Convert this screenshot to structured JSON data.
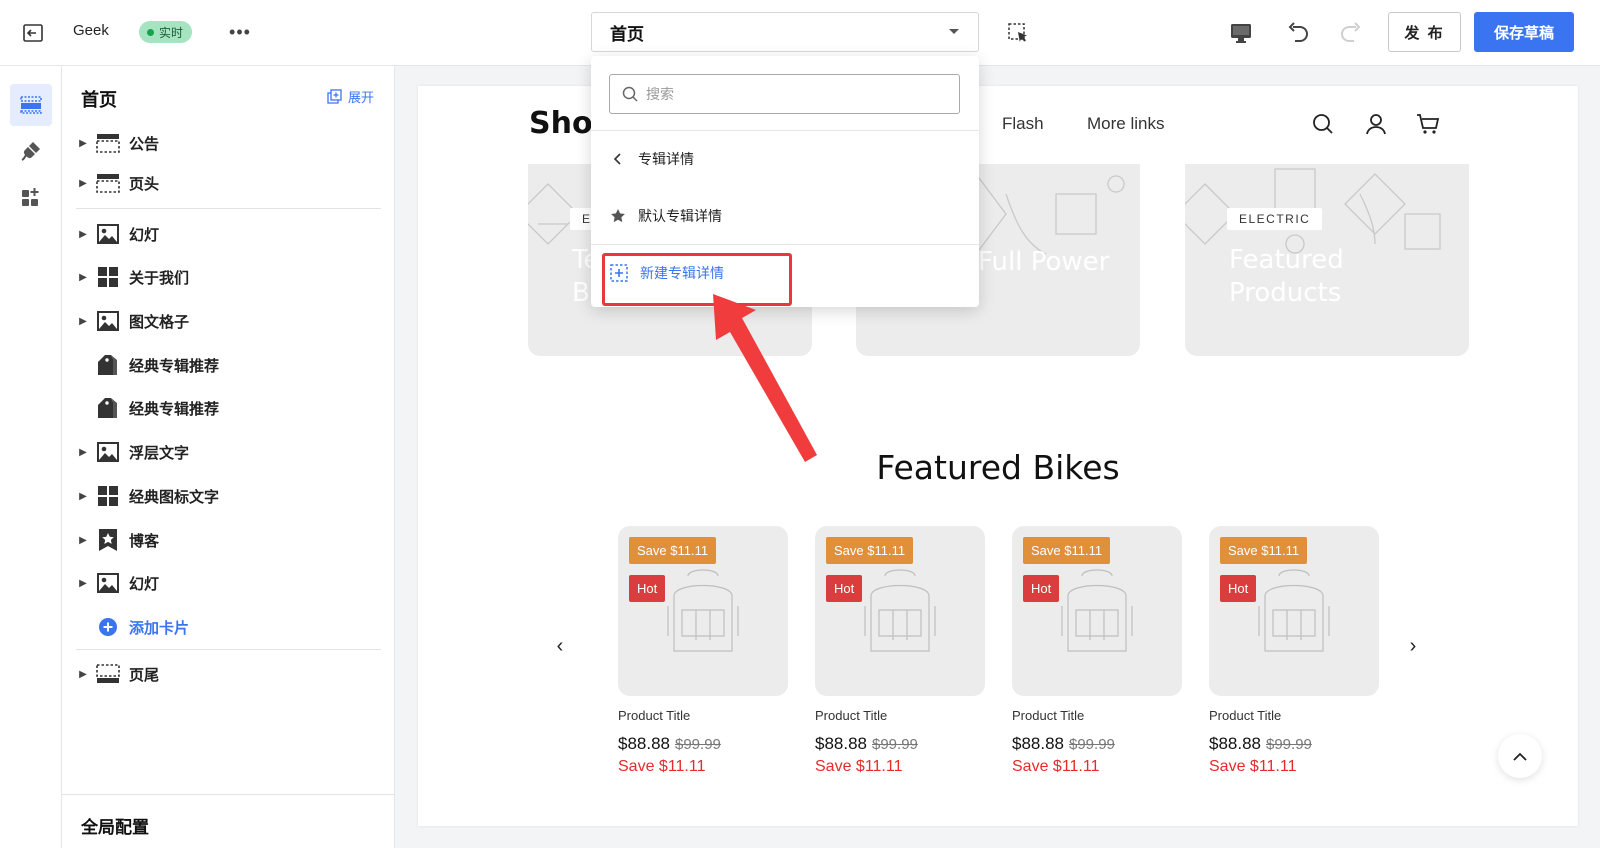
{
  "topbar": {
    "store_name": "Geek",
    "status_badge": "实时",
    "more": "•••",
    "page_select": "首页",
    "publish_label": "发 布",
    "save_draft_label": "保存草稿"
  },
  "sidebar": {
    "title": "首页",
    "expand_label": "展开",
    "items": [
      {
        "label": "公告",
        "icon": "header-section-icon",
        "caret": true
      },
      {
        "label": "页头",
        "icon": "header-section-icon",
        "caret": true
      },
      {
        "label": "幻灯",
        "icon": "image-icon",
        "caret": true
      },
      {
        "label": "关于我们",
        "icon": "grid-icon",
        "caret": true
      },
      {
        "label": "图文格子",
        "icon": "image-icon",
        "caret": true
      },
      {
        "label": "经典专辑推荐",
        "icon": "tag-icon",
        "caret": false
      },
      {
        "label": "经典专辑推荐",
        "icon": "tag-icon",
        "caret": false
      },
      {
        "label": "浮层文字",
        "icon": "image-icon",
        "caret": true
      },
      {
        "label": "经典图标文字",
        "icon": "grid-icon",
        "caret": true
      },
      {
        "label": "博客",
        "icon": "star-bookmark-icon",
        "caret": true
      },
      {
        "label": "幻灯",
        "icon": "image-icon",
        "caret": true
      }
    ],
    "add_card_label": "添加卡片",
    "footer_item": "页尾",
    "global_config": "全局配置"
  },
  "canvas": {
    "logo": "Shop",
    "nav_links": [
      "Flash",
      "More links"
    ],
    "collections": [
      {
        "tag": "E",
        "title": "Te\nB"
      },
      {
        "tag": "",
        "title": "Full Power"
      },
      {
        "tag": "ELECTRIC",
        "title": "Featured\nProducts"
      }
    ],
    "section_title": "Featured Bikes",
    "products": [
      {
        "save_badge": "Save $11.11",
        "hot_badge": "Hot",
        "title": "Product Title",
        "price": "$88.88",
        "original_price": "$99.99",
        "save_text": "Save $11.11"
      },
      {
        "save_badge": "Save $11.11",
        "hot_badge": "Hot",
        "title": "Product Title",
        "price": "$88.88",
        "original_price": "$99.99",
        "save_text": "Save $11.11"
      },
      {
        "save_badge": "Save $11.11",
        "hot_badge": "Hot",
        "title": "Product Title",
        "price": "$88.88",
        "original_price": "$99.99",
        "save_text": "Save $11.11"
      },
      {
        "save_badge": "Save $11.11",
        "hot_badge": "Hot",
        "title": "Product Title",
        "price": "$88.88",
        "original_price": "$99.99",
        "save_text": "Save $11.11"
      }
    ]
  },
  "dropdown": {
    "search_placeholder": "搜索",
    "back_item": "专辑详情",
    "default_item": "默认专辑详情",
    "new_item": "新建专辑详情"
  },
  "colors": {
    "accent": "#3b74f1",
    "status_green": "#a6e3c0",
    "save_badge": "#e08f3b",
    "hot_badge": "#d93d3d",
    "sale_red": "#e52b2b",
    "annotation_red": "#e8383d"
  }
}
